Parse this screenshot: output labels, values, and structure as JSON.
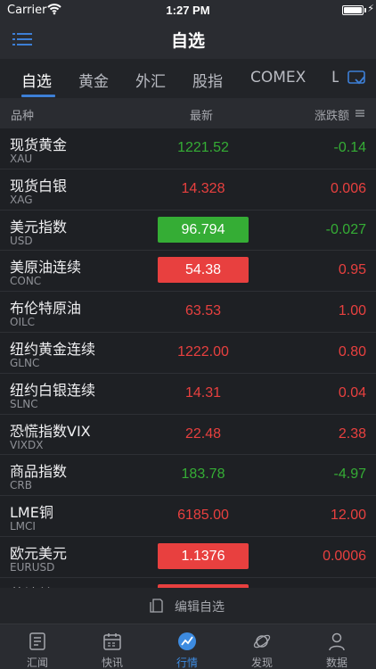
{
  "status_bar": {
    "carrier": "Carrier",
    "time": "1:27 PM"
  },
  "nav": {
    "title": "自选"
  },
  "tabs": [
    {
      "label": "自选",
      "active": true
    },
    {
      "label": "黄金",
      "active": false
    },
    {
      "label": "外汇",
      "active": false
    },
    {
      "label": "股指",
      "active": false
    },
    {
      "label": "COMEX",
      "active": false
    },
    {
      "label": "L",
      "active": false
    }
  ],
  "columns": {
    "name": "品种",
    "latest": "最新",
    "change": "涨跌额"
  },
  "rows": [
    {
      "name": "现货黄金",
      "code": "XAU",
      "price": "1221.52",
      "change": "-0.14",
      "dir": "down",
      "highlight": false
    },
    {
      "name": "现货白银",
      "code": "XAG",
      "price": "14.328",
      "change": "0.006",
      "dir": "up",
      "highlight": false
    },
    {
      "name": "美元指数",
      "code": "USD",
      "price": "96.794",
      "change": "-0.027",
      "dir": "down",
      "highlight": true
    },
    {
      "name": "美原油连续",
      "code": "CONC",
      "price": "54.38",
      "change": "0.95",
      "dir": "up",
      "highlight": true
    },
    {
      "name": "布伦特原油",
      "code": "OILC",
      "price": "63.53",
      "change": "1.00",
      "dir": "up",
      "highlight": false
    },
    {
      "name": "纽约黄金连续",
      "code": "GLNC",
      "price": "1222.00",
      "change": "0.80",
      "dir": "up",
      "highlight": false
    },
    {
      "name": "纽约白银连续",
      "code": "SLNC",
      "price": "14.31",
      "change": "0.04",
      "dir": "up",
      "highlight": false
    },
    {
      "name": "恐慌指数VIX",
      "code": "VIXDX",
      "price": "22.48",
      "change": "2.38",
      "dir": "up",
      "highlight": false
    },
    {
      "name": "商品指数",
      "code": "CRB",
      "price": "183.78",
      "change": "-4.97",
      "dir": "down",
      "highlight": false
    },
    {
      "name": "LME铜",
      "code": "LMCI",
      "price": "6185.00",
      "change": "12.00",
      "dir": "up",
      "highlight": false
    },
    {
      "name": "欧元美元",
      "code": "EURUSD",
      "price": "1.1376",
      "change": "0.0006",
      "dir": "up",
      "highlight": true
    },
    {
      "name": "英镑美元",
      "code": "GBPUSD",
      "price": "",
      "change": "",
      "dir": "up",
      "highlight": true
    }
  ],
  "edit": {
    "label": "编辑自选"
  },
  "tab_bar": [
    {
      "label": "汇闻",
      "icon": "news-doc-icon",
      "active": false
    },
    {
      "label": "快讯",
      "icon": "calendar-icon",
      "active": false
    },
    {
      "label": "行情",
      "icon": "market-chart-icon",
      "active": true
    },
    {
      "label": "发现",
      "icon": "discover-planet-icon",
      "active": false
    },
    {
      "label": "数据",
      "icon": "person-icon",
      "active": false
    }
  ],
  "colors": {
    "up": "#e8403f",
    "down": "#35ad35",
    "accent": "#3d8be0"
  }
}
